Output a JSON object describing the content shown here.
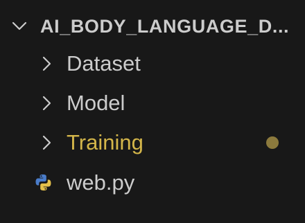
{
  "explorer": {
    "section_title": "AI_BODY_LANGUAGE_D...",
    "items": [
      {
        "label": "Dataset",
        "type": "folder"
      },
      {
        "label": "Model",
        "type": "folder"
      },
      {
        "label": "Training",
        "type": "folder",
        "modified": true
      },
      {
        "label": "web.py",
        "type": "file",
        "icon": "python-icon"
      }
    ]
  },
  "colors": {
    "background": "#181818",
    "text": "#cccccc",
    "modified_text": "#d4b64a",
    "modified_dot": "#8c7a3d",
    "python_blue": "#4a7cc9",
    "python_yellow": "#e5c14b"
  }
}
